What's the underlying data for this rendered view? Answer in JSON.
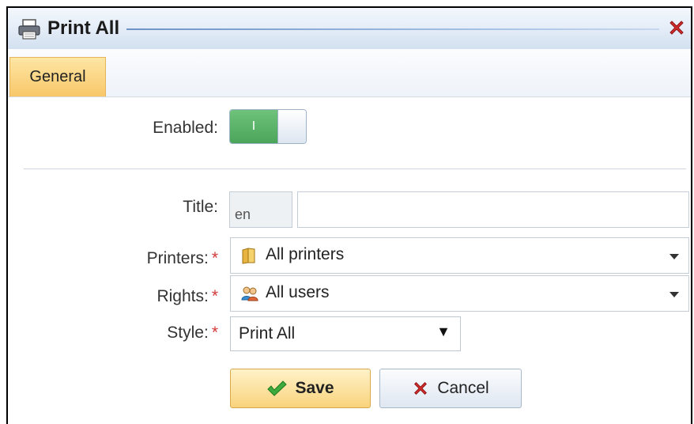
{
  "dialog": {
    "title": "Print All",
    "printer_icon": "printer-icon",
    "close_icon": "close-icon"
  },
  "tabs": [
    {
      "label": "General",
      "active": true
    }
  ],
  "form": {
    "enabled": {
      "label": "Enabled:",
      "state": "I",
      "value": true
    },
    "title": {
      "label": "Title:",
      "lang": "en",
      "value": ""
    },
    "printers": {
      "label": "Printers:",
      "required": "*",
      "value": "All printers",
      "icon": "folder-icon"
    },
    "rights": {
      "label": "Rights:",
      "required": "*",
      "value": "All users",
      "icon": "users-icon"
    },
    "style": {
      "label": "Style:",
      "required": "*",
      "value": "Print All",
      "caret": "▼"
    }
  },
  "buttons": {
    "save": {
      "label": "Save",
      "icon": "checkmark-icon"
    },
    "cancel": {
      "label": "Cancel",
      "icon": "x-icon"
    }
  },
  "colors": {
    "toggle_on": "#4aa55a",
    "tab_active": "#f8c769",
    "required": "#d23a3a"
  }
}
